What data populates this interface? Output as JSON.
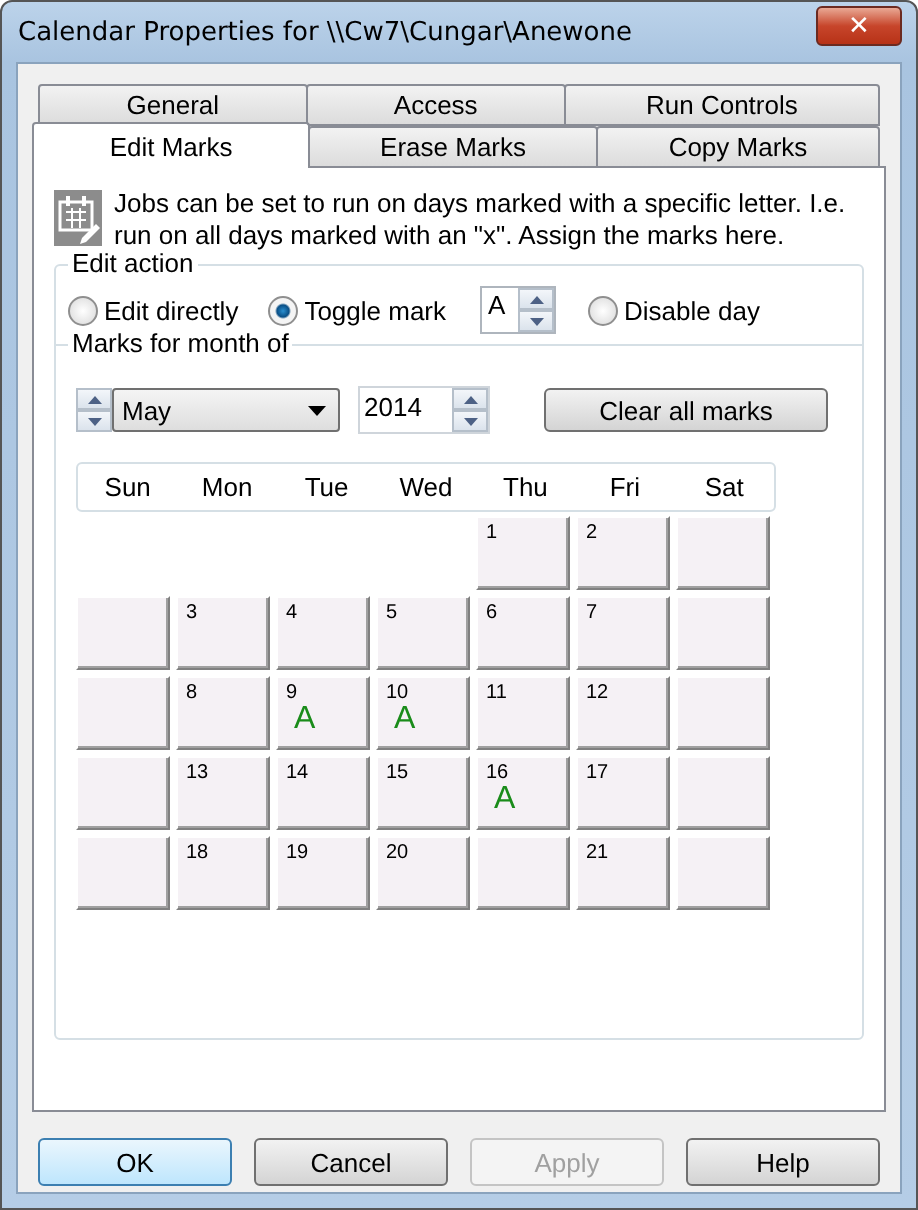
{
  "window": {
    "title": "Calendar Properties for \\\\Cw7\\Cungar\\Anewone",
    "close": "✕"
  },
  "tab_rows": [
    {
      "tabs": [
        {
          "label": "General",
          "selected": false
        },
        {
          "label": "Access",
          "selected": false
        },
        {
          "label": "Run Controls",
          "selected": false
        }
      ]
    },
    {
      "tabs": [
        {
          "label": "Edit Marks",
          "selected": true
        },
        {
          "label": "Erase Marks",
          "selected": false
        },
        {
          "label": "Copy Marks",
          "selected": false
        }
      ]
    }
  ],
  "description": "Jobs can be set to run on days marked with a specific letter. I.e. run on all days marked with an \"x\".  Assign the marks here.",
  "edit_action": {
    "title": "Edit action",
    "options": [
      {
        "kind": "radio",
        "label": "Edit directly",
        "selected": false
      },
      {
        "kind": "radio",
        "label": "Toggle mark",
        "selected": true
      },
      {
        "kind": "spinner",
        "value": "A"
      },
      {
        "kind": "radio",
        "label": "Disable day",
        "selected": false
      }
    ]
  },
  "month_section": {
    "title": "Marks for month of",
    "month": "May",
    "year": "2014",
    "clear_button": "Clear all marks"
  },
  "weekdays": [
    "Sun",
    "Mon",
    "Tue",
    "Wed",
    "Thu",
    "Fri",
    "Sat"
  ],
  "weeks": [
    {
      "cells": [
        {
          "kind": "none"
        },
        {
          "kind": "none"
        },
        {
          "kind": "none"
        },
        {
          "kind": "none"
        },
        {
          "kind": "day",
          "day": "1"
        },
        {
          "kind": "day",
          "day": "2"
        },
        {
          "kind": "blank"
        }
      ]
    },
    {
      "cells": [
        {
          "kind": "blank"
        },
        {
          "kind": "day",
          "day": "3"
        },
        {
          "kind": "day",
          "day": "4"
        },
        {
          "kind": "day",
          "day": "5"
        },
        {
          "kind": "day",
          "day": "6"
        },
        {
          "kind": "day",
          "day": "7"
        },
        {
          "kind": "blank"
        }
      ]
    },
    {
      "cells": [
        {
          "kind": "blank"
        },
        {
          "kind": "day",
          "day": "8"
        },
        {
          "kind": "day",
          "day": "9",
          "mark": "A"
        },
        {
          "kind": "day",
          "day": "10",
          "mark": "A"
        },
        {
          "kind": "day",
          "day": "11"
        },
        {
          "kind": "day",
          "day": "12"
        },
        {
          "kind": "blank"
        }
      ]
    },
    {
      "cells": [
        {
          "kind": "blank"
        },
        {
          "kind": "day",
          "day": "13"
        },
        {
          "kind": "day",
          "day": "14"
        },
        {
          "kind": "day",
          "day": "15"
        },
        {
          "kind": "day",
          "day": "16",
          "mark": "A"
        },
        {
          "kind": "day",
          "day": "17"
        },
        {
          "kind": "blank"
        }
      ]
    },
    {
      "cells": [
        {
          "kind": "blank"
        },
        {
          "kind": "day",
          "day": "18"
        },
        {
          "kind": "day",
          "day": "19"
        },
        {
          "kind": "day",
          "day": "20"
        },
        {
          "kind": "blank"
        },
        {
          "kind": "day",
          "day": "21"
        },
        {
          "kind": "blank"
        }
      ]
    }
  ],
  "buttons": [
    {
      "label": "OK",
      "default": true,
      "disabled": false
    },
    {
      "label": "Cancel",
      "default": false,
      "disabled": false
    },
    {
      "label": "Apply",
      "default": false,
      "disabled": true
    },
    {
      "label": "Help",
      "default": false,
      "disabled": false
    }
  ]
}
